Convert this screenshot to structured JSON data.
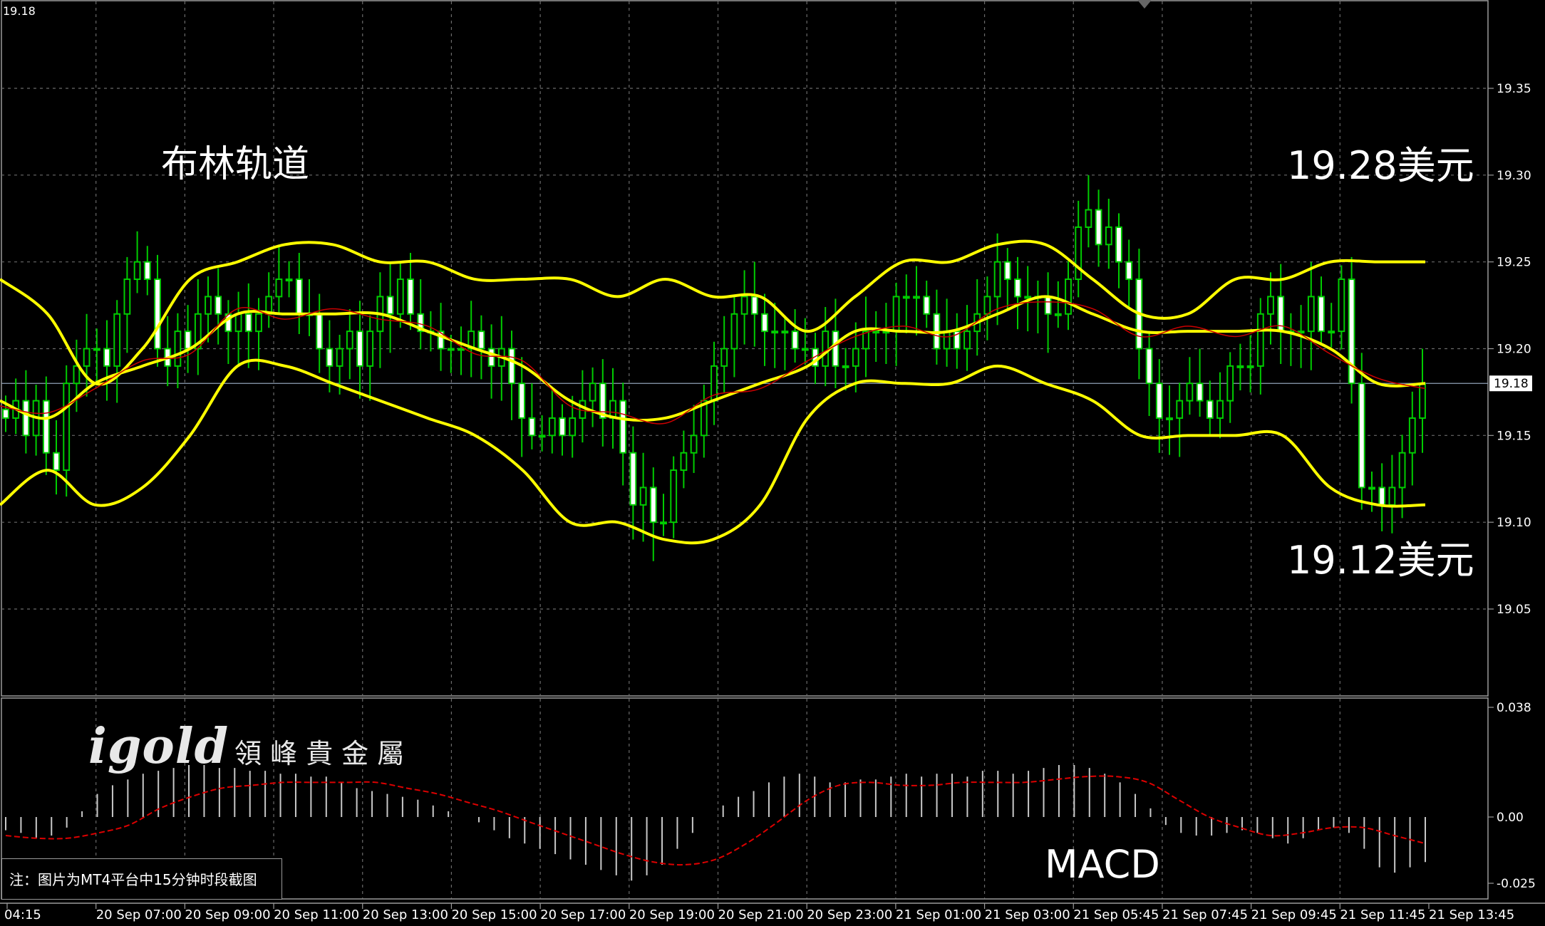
{
  "chart_title": "布林轨道",
  "top_left_price": "19.18",
  "annotations": {
    "high": "19.28美元",
    "low": "19.12美元"
  },
  "macd_title": "MACD",
  "note": "注：图片为MT4平台中15分钟时段截图",
  "logo": {
    "main": "igold",
    "cn": "領峰貴金屬"
  },
  "current_price": "19.18",
  "colors": {
    "background": "#000000",
    "grid": "#6a6a6a",
    "candle": "#00cc00",
    "bollinger": "#ffff00",
    "middle_ma": "#cc0000",
    "macd_hist": "#c8c8c8",
    "macd_signal": "#dd0000"
  },
  "chart_data": [
    {
      "type": "candlestick",
      "title": "布林轨道",
      "timeframe": "15 min",
      "y_ticks": [
        "19.35",
        "19.30",
        "19.25",
        "19.20",
        "19.15",
        "19.10",
        "19.05"
      ],
      "ylim": [
        19.0,
        19.4
      ],
      "current_price": 19.18,
      "x_ticks": [
        "04:15",
        "20 Sep 07:00",
        "20 Sep 09:00",
        "20 Sep 11:00",
        "20 Sep 13:00",
        "20 Sep 15:00",
        "20 Sep 17:00",
        "20 Sep 19:00",
        "20 Sep 21:00",
        "20 Sep 23:00",
        "21 Sep 01:00",
        "21 Sep 03:00",
        "21 Sep 05:45",
        "21 Sep 07:45",
        "21 Sep 09:45",
        "21 Sep 11:45",
        "21 Sep 13:45"
      ],
      "close_series": [
        19.16,
        19.17,
        19.15,
        19.17,
        19.14,
        19.13,
        19.18,
        19.19,
        19.2,
        19.2,
        19.19,
        19.22,
        19.24,
        19.25,
        19.24,
        19.2,
        19.19,
        19.21,
        19.2,
        19.22,
        19.23,
        19.22,
        19.21,
        19.22,
        19.21,
        19.22,
        19.23,
        19.24,
        19.24,
        19.22,
        19.22,
        19.2,
        19.19,
        19.2,
        19.21,
        19.19,
        19.21,
        19.23,
        19.22,
        19.24,
        19.22,
        19.21,
        19.21,
        19.2,
        19.2,
        19.2,
        19.21,
        19.2,
        19.19,
        19.2,
        19.18,
        19.16,
        19.15,
        19.15,
        19.16,
        19.15,
        19.16,
        19.17,
        19.18,
        19.16,
        19.17,
        19.14,
        19.11,
        19.12,
        19.1,
        19.1,
        19.13,
        19.14,
        19.15,
        19.17,
        19.19,
        19.2,
        19.22,
        19.23,
        19.22,
        19.21,
        19.21,
        19.21,
        19.2,
        19.2,
        19.19,
        19.21,
        19.19,
        19.19,
        19.2,
        19.21,
        19.21,
        19.21,
        19.23,
        19.23,
        19.23,
        19.22,
        19.2,
        19.21,
        19.2,
        19.21,
        19.22,
        19.23,
        19.25,
        19.24,
        19.23,
        19.23,
        19.23,
        19.22,
        19.22,
        19.24,
        19.27,
        19.28,
        19.26,
        19.27,
        19.25,
        19.24,
        19.2,
        19.18,
        19.16,
        19.16,
        19.17,
        19.18,
        19.17,
        19.16,
        19.17,
        19.19,
        19.19,
        19.19,
        19.22,
        19.23,
        19.21,
        19.21,
        19.21,
        19.23,
        19.21,
        19.21,
        19.24,
        19.18,
        19.12,
        19.12,
        19.11,
        19.12,
        19.14,
        19.16,
        19.18
      ],
      "bollinger_upper": [
        19.24,
        19.22,
        19.18,
        19.2,
        19.24,
        19.25,
        19.26,
        19.26,
        19.25,
        19.25,
        19.24,
        19.24,
        19.24,
        19.23,
        19.24,
        19.23,
        19.23,
        19.21,
        19.23,
        19.25,
        19.25,
        19.26,
        19.26,
        19.24,
        19.22,
        19.22,
        19.24,
        19.24,
        19.25,
        19.25,
        19.25
      ],
      "bollinger_middle": [
        19.17,
        19.16,
        19.18,
        19.19,
        19.2,
        19.22,
        19.22,
        19.22,
        19.22,
        19.21,
        19.2,
        19.19,
        19.17,
        19.16,
        19.16,
        19.17,
        19.18,
        19.19,
        19.21,
        19.21,
        19.21,
        19.22,
        19.23,
        19.22,
        19.21,
        19.21,
        19.21,
        19.21,
        19.2,
        19.18,
        19.18
      ],
      "bollinger_lower": [
        19.11,
        19.13,
        19.11,
        19.12,
        19.15,
        19.19,
        19.19,
        19.18,
        19.17,
        19.16,
        19.15,
        19.13,
        19.1,
        19.1,
        19.09,
        19.09,
        19.11,
        19.16,
        19.18,
        19.18,
        19.18,
        19.19,
        19.18,
        19.17,
        19.15,
        19.15,
        19.15,
        19.15,
        19.12,
        19.11,
        19.11
      ]
    },
    {
      "type": "bar",
      "title": "MACD",
      "y_ticks": [
        "0.038",
        "0.00",
        "-0.025"
      ],
      "ylim": [
        -0.029,
        0.045
      ],
      "histogram": [
        -0.005,
        -0.006,
        -0.008,
        -0.007,
        -0.004,
        0.002,
        0.008,
        0.011,
        0.013,
        0.015,
        0.016,
        0.017,
        0.018,
        0.018,
        0.017,
        0.017,
        0.016,
        0.016,
        0.015,
        0.015,
        0.014,
        0.014,
        0.012,
        0.01,
        0.009,
        0.008,
        0.007,
        0.006,
        0.004,
        0.002,
        0.0,
        -0.002,
        -0.005,
        -0.008,
        -0.01,
        -0.012,
        -0.014,
        -0.016,
        -0.018,
        -0.02,
        -0.022,
        -0.024,
        -0.022,
        -0.018,
        -0.012,
        -0.006,
        0.0,
        0.004,
        0.007,
        0.009,
        0.012,
        0.014,
        0.015,
        0.014,
        0.012,
        0.012,
        0.013,
        0.013,
        0.014,
        0.015,
        0.014,
        0.015,
        0.015,
        0.014,
        0.016,
        0.016,
        0.015,
        0.016,
        0.017,
        0.018,
        0.018,
        0.017,
        0.015,
        0.012,
        0.008,
        0.003,
        -0.003,
        -0.006,
        -0.007,
        -0.007,
        -0.006,
        -0.005,
        -0.006,
        -0.008,
        -0.01,
        -0.008,
        -0.005,
        -0.004,
        -0.006,
        -0.012,
        -0.019,
        -0.021,
        -0.019,
        -0.017
      ],
      "signal": [
        -0.007,
        -0.008,
        -0.008,
        -0.006,
        -0.003,
        0.003,
        0.007,
        0.01,
        0.011,
        0.012,
        0.012,
        0.012,
        0.012,
        0.01,
        0.008,
        0.005,
        0.002,
        -0.002,
        -0.006,
        -0.01,
        -0.014,
        -0.017,
        -0.018,
        -0.016,
        -0.01,
        -0.002,
        0.006,
        0.011,
        0.012,
        0.011,
        0.011,
        0.012,
        0.012,
        0.012,
        0.013,
        0.014,
        0.014,
        0.012,
        0.006,
        0.0,
        -0.004,
        -0.007,
        -0.006,
        -0.004,
        -0.004,
        -0.007,
        -0.01
      ]
    }
  ]
}
